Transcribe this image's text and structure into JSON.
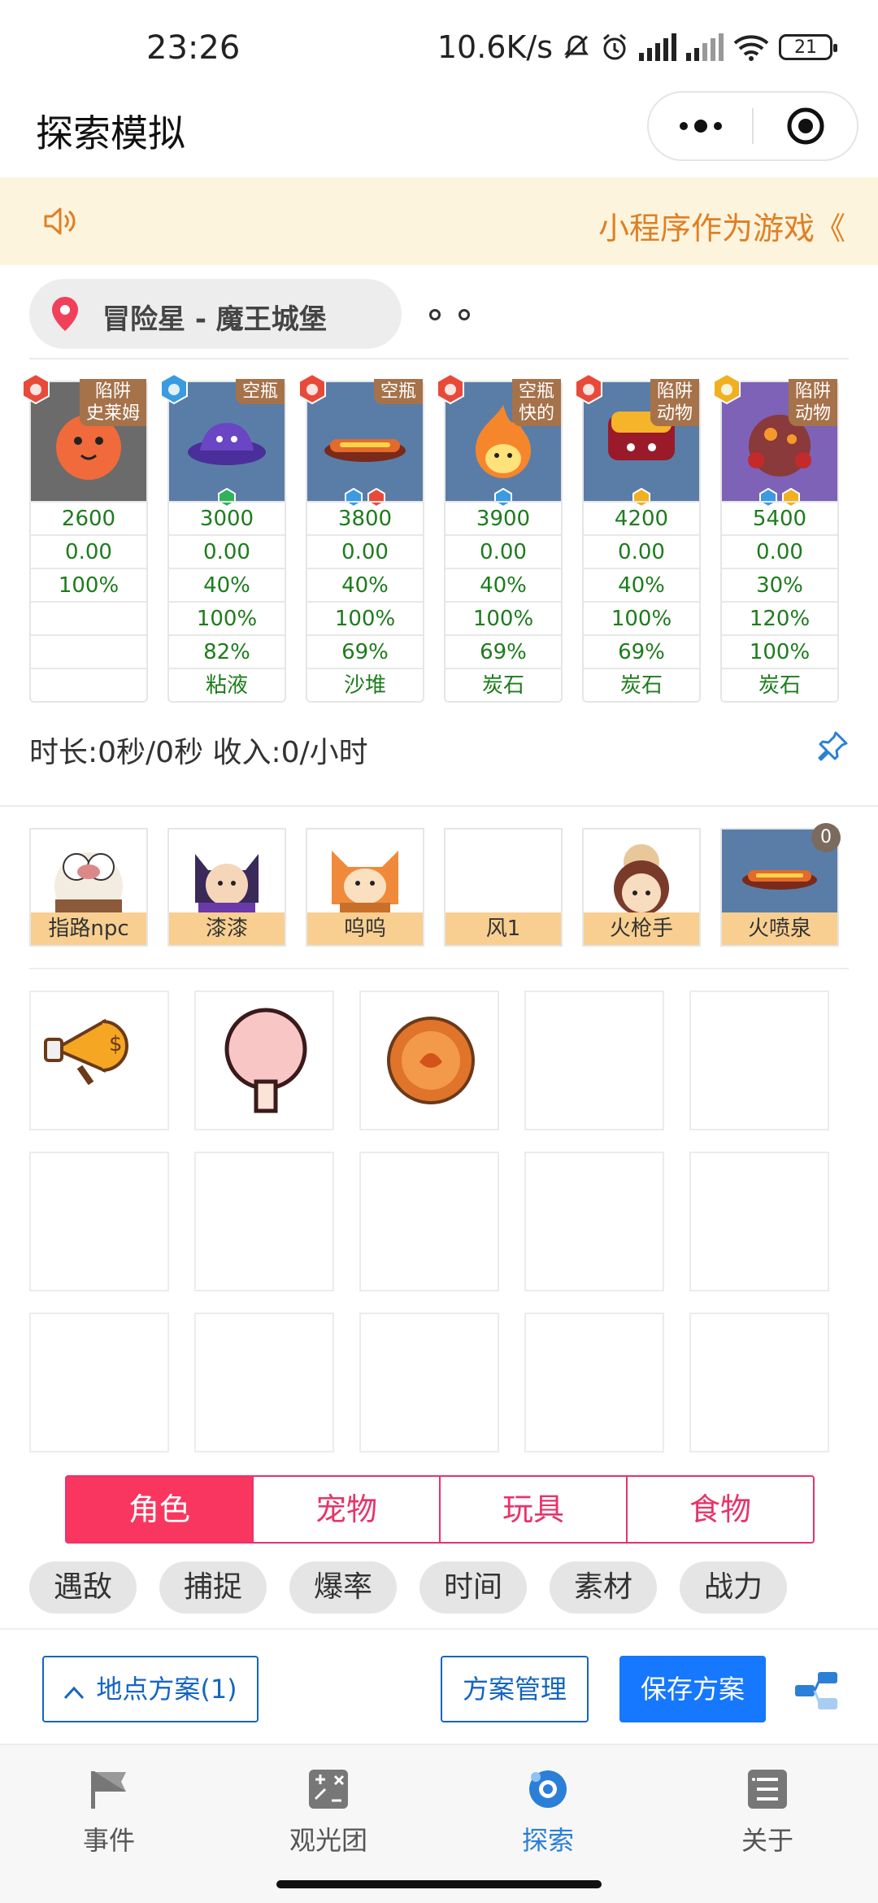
{
  "status_bar": {
    "time": "23:26",
    "net_speed": "10.6K/s",
    "battery": "21"
  },
  "title_bar": {
    "title": "探索模拟"
  },
  "notice": {
    "text": "小程序作为游戏《"
  },
  "location": {
    "label": "冒险星 - 魔王城堡"
  },
  "monsters": [
    {
      "tag": "陷阱\n史莱姆",
      "element": "fire",
      "bg": "#6b6b6b",
      "gems": [],
      "values": [
        "2600",
        "0.00",
        "100%",
        "",
        "",
        ""
      ]
    },
    {
      "tag": "空瓶",
      "element": "water",
      "bg": "#5a7da8",
      "gems": [
        "green"
      ],
      "values": [
        "3000",
        "0.00",
        "40%",
        "100%",
        "82%",
        "粘液"
      ]
    },
    {
      "tag": "空瓶",
      "element": "fire",
      "bg": "#5a7da8",
      "gems": [
        "blue",
        "red"
      ],
      "values": [
        "3800",
        "0.00",
        "40%",
        "100%",
        "69%",
        "沙堆"
      ]
    },
    {
      "tag": "空瓶\n快的",
      "element": "fire",
      "bg": "#5a7da8",
      "gems": [
        "blue"
      ],
      "values": [
        "3900",
        "0.00",
        "40%",
        "100%",
        "69%",
        "炭石"
      ]
    },
    {
      "tag": "陷阱\n动物",
      "element": "fire",
      "bg": "#5a7da8",
      "gems": [
        "gold"
      ],
      "values": [
        "4200",
        "0.00",
        "40%",
        "100%",
        "69%",
        "炭石"
      ]
    },
    {
      "tag": "陷阱\n动物",
      "element": "gold",
      "bg": "#7d62b8",
      "gems": [
        "blue",
        "gold"
      ],
      "values": [
        "5400",
        "0.00",
        "30%",
        "120%",
        "100%",
        "炭石"
      ]
    }
  ],
  "summary": {
    "text": "时长:0秒/0秒 收入:0/小时"
  },
  "team": [
    {
      "name": "指路npc"
    },
    {
      "name": "漆漆"
    },
    {
      "name": "呜呜"
    },
    {
      "name": "风1"
    },
    {
      "name": "火枪手"
    },
    {
      "name": "火喷泉",
      "count": "0"
    }
  ],
  "items": [
    "money-horn",
    "cotton-candy",
    "orange-coin"
  ],
  "tabs": [
    {
      "label": "角色",
      "active": true
    },
    {
      "label": "宠物"
    },
    {
      "label": "玩具"
    },
    {
      "label": "食物"
    }
  ],
  "chips": [
    "遇敌",
    "捕捉",
    "爆率",
    "时间",
    "素材",
    "战力"
  ],
  "actions": {
    "location_plan": "地点方案(1)",
    "manage": "方案管理",
    "save": "保存方案"
  },
  "nav": [
    {
      "label": "事件",
      "icon": "flag-icon"
    },
    {
      "label": "观光团",
      "icon": "calc-icon"
    },
    {
      "label": "探索",
      "icon": "explore-icon",
      "active": true
    },
    {
      "label": "关于",
      "icon": "list-icon"
    }
  ],
  "colors": {
    "accent": "#f9365f",
    "primary": "#1677ff",
    "green_text": "#1d7c1d",
    "notice_text": "#e07f24"
  }
}
